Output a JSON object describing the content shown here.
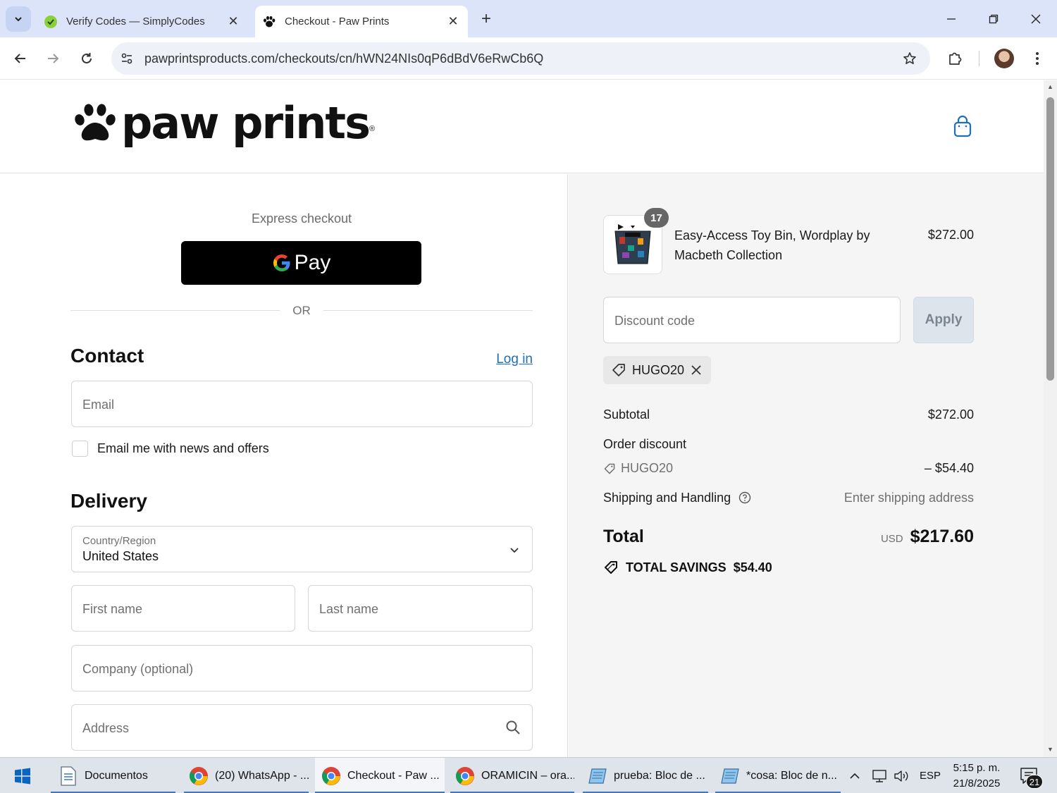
{
  "browser": {
    "tabs": [
      {
        "title": "Verify Codes — SimplyCodes",
        "icon": "simplycodes-icon",
        "active": false
      },
      {
        "title": "Checkout - Paw Prints",
        "icon": "paw-icon",
        "active": true
      }
    ],
    "url": "pawprintsproducts.com/checkouts/cn/hWN24NIs0qP6dBdV6eRwCb6Q"
  },
  "header": {
    "logo_text": "paw prints",
    "logo_reg": "®"
  },
  "express": {
    "label": "Express checkout",
    "gpay_label": "Pay",
    "or": "OR"
  },
  "contact": {
    "title": "Contact",
    "login_link": "Log in",
    "email_placeholder": "Email",
    "newsletter_label": "Email me with news and offers"
  },
  "delivery": {
    "title": "Delivery",
    "country_label": "Country/Region",
    "country_value": "United States",
    "first_name_placeholder": "First name",
    "last_name_placeholder": "Last name",
    "company_placeholder": "Company (optional)",
    "address_placeholder": "Address"
  },
  "summary": {
    "product": {
      "quantity": "17",
      "name": "Easy-Access Toy Bin, Wordplay by Macbeth Collection",
      "price": "$272.00"
    },
    "discount_placeholder": "Discount code",
    "apply_label": "Apply",
    "applied_code": "HUGO20",
    "subtotal_label": "Subtotal",
    "subtotal_value": "$272.00",
    "order_discount_label": "Order discount",
    "discount_code": "HUGO20",
    "discount_value": "– $54.40",
    "shipping_label": "Shipping and Handling",
    "shipping_value": "Enter shipping address",
    "total_label": "Total",
    "total_currency": "USD",
    "total_value": "$217.60",
    "savings_label": "TOTAL SAVINGS",
    "savings_value": "$54.40"
  },
  "taskbar": {
    "items": [
      {
        "label": "Documentos",
        "icon": "document-icon"
      },
      {
        "label": "(20) WhatsApp - ...",
        "icon": "chrome-icon"
      },
      {
        "label": "Checkout - Paw ...",
        "icon": "chrome-icon"
      },
      {
        "label": "ORAMICIN – ora...",
        "icon": "chrome-icon"
      },
      {
        "label": "prueba: Bloc de ...",
        "icon": "notepad-icon"
      },
      {
        "label": "*cosa: Bloc de n...",
        "icon": "notepad-icon"
      }
    ],
    "language": "ESP",
    "time": "5:15 p. m.",
    "date": "21/8/2025",
    "notification_count": "21"
  },
  "colors": {
    "link": "#1f6fb5",
    "gpay_bg": "#000000",
    "summary_bg": "#f5f5f5",
    "tabbar_bg": "#dbe4f9"
  }
}
